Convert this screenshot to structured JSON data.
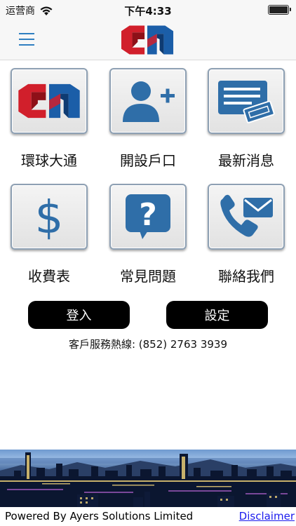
{
  "status_bar": {
    "carrier": "运营商",
    "time": "下午4:33",
    "battery_level": 1.0
  },
  "nav": {
    "menu_icon": "hamburger-menu-icon",
    "logo": "company-logo"
  },
  "tiles": [
    {
      "label": "環球大通",
      "icon": "company-logo"
    },
    {
      "label": "開設戶口",
      "icon": "add-user-icon"
    },
    {
      "label": "最新消息",
      "icon": "news-icon"
    },
    {
      "label": "收費表",
      "icon": "dollar-icon"
    },
    {
      "label": "常見問題",
      "icon": "question-icon"
    },
    {
      "label": "聯絡我們",
      "icon": "contact-icon"
    }
  ],
  "buttons": {
    "login_label": "登入",
    "settings_label": "設定"
  },
  "hotline": "客戶服務熱線:  (852) 2763 3939",
  "footer": {
    "powered_by": "Powered By Ayers Solutions Limited",
    "disclaimer": "Disclaimer"
  },
  "colors": {
    "icon_blue": "#2f6ea8",
    "logo_red": "#d11f2b",
    "logo_blue": "#1b5ea8",
    "button_bg": "#000000",
    "link_blue": "#1a1aee"
  }
}
